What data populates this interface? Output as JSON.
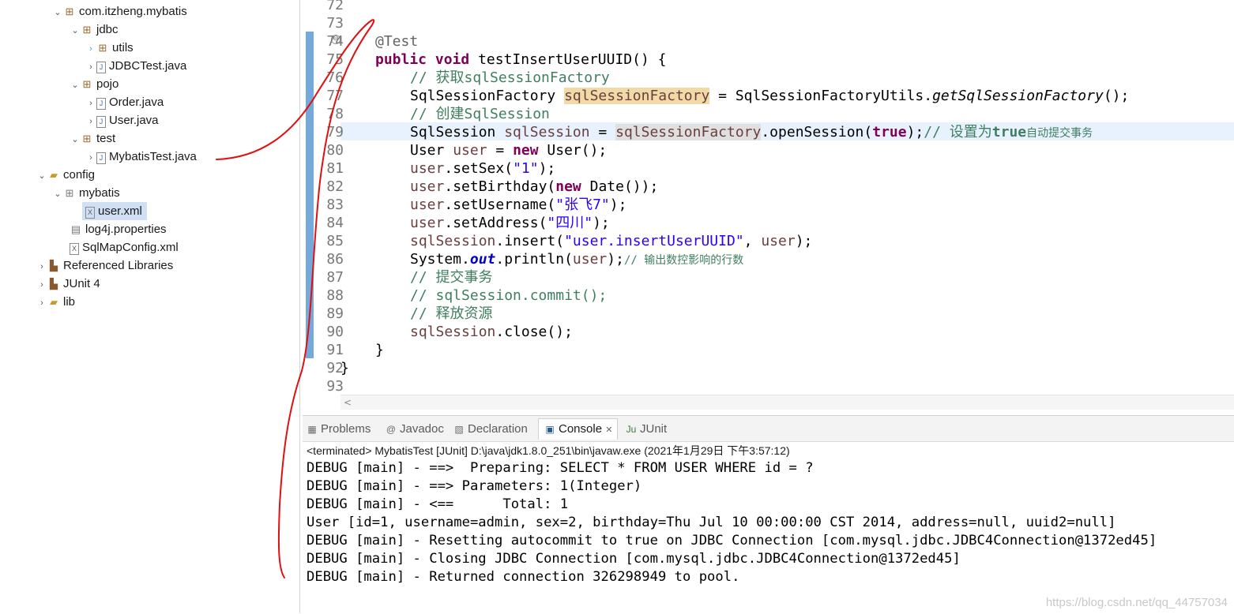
{
  "tree": {
    "items": [
      {
        "label": "com.itzheng.mybatis",
        "type": "package",
        "expanded": true
      },
      {
        "label": "jdbc",
        "type": "package",
        "expanded": true
      },
      {
        "label": "utils",
        "type": "package",
        "expanded": false
      },
      {
        "label": "JDBCTest.java",
        "type": "java",
        "expanded": false
      },
      {
        "label": "pojo",
        "type": "package",
        "expanded": true
      },
      {
        "label": "Order.java",
        "type": "java",
        "expanded": false
      },
      {
        "label": "User.java",
        "type": "java",
        "expanded": false
      },
      {
        "label": "test",
        "type": "package",
        "expanded": true
      },
      {
        "label": "MybatisTest.java",
        "type": "java",
        "expanded": false
      },
      {
        "label": "config",
        "type": "folder",
        "expanded": true
      },
      {
        "label": "mybatis",
        "type": "package",
        "expanded": true
      },
      {
        "label": "user.xml",
        "type": "xml",
        "selected": true
      },
      {
        "label": "log4j.properties",
        "type": "file"
      },
      {
        "label": "SqlMapConfig.xml",
        "type": "xml"
      },
      {
        "label": "Referenced Libraries",
        "type": "lib",
        "expanded": false
      },
      {
        "label": "JUnit 4",
        "type": "lib",
        "expanded": false
      },
      {
        "label": "lib",
        "type": "folder",
        "expanded": false
      }
    ]
  },
  "editor": {
    "line_numbers": [
      "72",
      "73",
      "74",
      "75",
      "76",
      "77",
      "78",
      "79",
      "80",
      "81",
      "82",
      "83",
      "84",
      "85",
      "86",
      "87",
      "88",
      "89",
      "90",
      "91",
      "92",
      "93"
    ],
    "fold_marker": "⊖",
    "code": {
      "l74": {
        "ann": "@Test"
      },
      "l75": {
        "kw1": "public",
        "kw2": "void",
        "rest": " testInsertUserUUID() {"
      },
      "l76": {
        "comment": "// 获取sqlSessionFactory"
      },
      "l77": {
        "type": "SqlSessionFactory ",
        "var": "sqlSessionFactory",
        "mid": " = SqlSessionFactoryUtils.",
        "method": "getSqlSessionFactory",
        "end": "();"
      },
      "l78": {
        "comment": "// 创建SqlSession"
      },
      "l79": {
        "type": "SqlSession ",
        "var": "sqlSession",
        "mid": " = ",
        "var2": "sqlSessionFactory",
        "call": ".openSession(",
        "kw": "true",
        "end": ");",
        "comment1": "// 设置为",
        "comment_kw": "true",
        "comment2": "自动提交事务"
      },
      "l80": {
        "type": "User ",
        "var": "user",
        "mid": " = ",
        "kw": "new",
        "end": " User();"
      },
      "l81": {
        "var": "user",
        "call": ".setSex(",
        "str": "\"1\"",
        "end": ");"
      },
      "l82": {
        "var": "user",
        "call": ".setBirthday(",
        "kw": "new",
        "end": " Date());"
      },
      "l83": {
        "var": "user",
        "call": ".setUsername(",
        "str": "\"张飞7\"",
        "end": ");"
      },
      "l84": {
        "var": "user",
        "call": ".setAddress(",
        "str": "\"四川\"",
        "end": ");"
      },
      "l85": {
        "var": "sqlSession",
        "call": ".insert(",
        "str": "\"user.insertUserUUID\"",
        "mid": ", ",
        "var2": "user",
        "end": ");"
      },
      "l86": {
        "pre": "System.",
        "field": "out",
        "call": ".println(",
        "var": "user",
        "end": ");",
        "comment": "// 输出数控影响的行数"
      },
      "l87": {
        "comment": "// 提交事务"
      },
      "l88": {
        "comment": "// sqlSession.commit();"
      },
      "l89": {
        "comment": "// 释放资源"
      },
      "l90": {
        "var": "sqlSession",
        "end": ".close();"
      },
      "l91": {
        "text": "}"
      },
      "l92": {
        "text": "}"
      }
    }
  },
  "bottom": {
    "tabs": [
      {
        "label": "Problems",
        "icon": "problems-icon"
      },
      {
        "label": "Javadoc",
        "icon": "at-icon"
      },
      {
        "label": "Declaration",
        "icon": "declaration-icon"
      },
      {
        "label": "Console",
        "icon": "console-icon",
        "active": true,
        "close": "✕"
      },
      {
        "label": "JUnit",
        "icon": "junit-icon"
      }
    ],
    "terminated": "<terminated> MybatisTest [JUnit] D:\\java\\jdk1.8.0_251\\bin\\javaw.exe (2021年1月29日 下午3:57:12)",
    "output": [
      "DEBUG [main] - ==>  Preparing: SELECT * FROM USER WHERE id = ?",
      "DEBUG [main] - ==> Parameters: 1(Integer)",
      "DEBUG [main] - <==      Total: 1",
      "User [id=1, username=admin, sex=2, birthday=Thu Jul 10 00:00:00 CST 2014, address=null, uuid2=null]",
      "DEBUG [main] - Resetting autocommit to true on JDBC Connection [com.mysql.jdbc.JDBC4Connection@1372ed45]",
      "DEBUG [main] - Closing JDBC Connection [com.mysql.jdbc.JDBC4Connection@1372ed45]",
      "DEBUG [main] - Returned connection 326298949 to pool."
    ],
    "watermark": "https://blog.csdn.net/qq_44757034"
  },
  "colors": {
    "annotation_stroke": "#e01010",
    "ruler": "#5b9bd5",
    "current_line": "#e8f2fe",
    "highlight": "#f2d9a8"
  }
}
